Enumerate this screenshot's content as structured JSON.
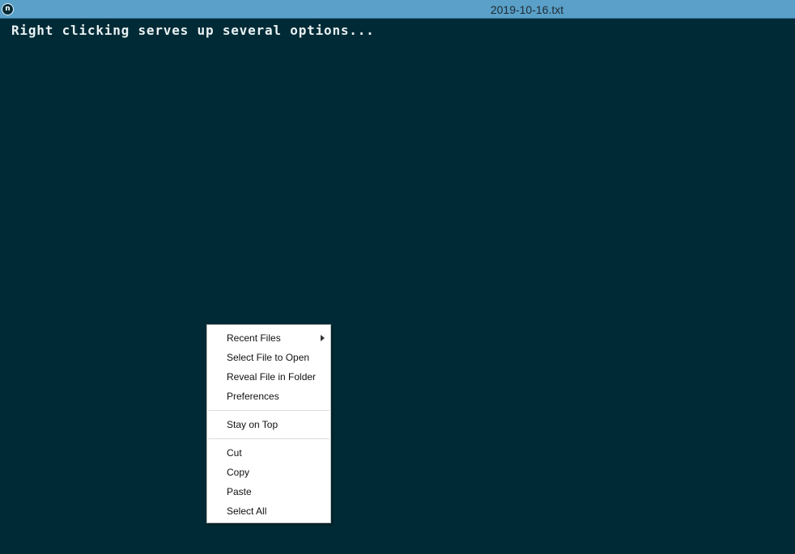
{
  "window": {
    "title": "2019-10-16.txt",
    "app_icon_letter": "n"
  },
  "editor": {
    "text": "Right clicking serves up several options..."
  },
  "context_menu": {
    "group_file": [
      {
        "label": "Recent Files",
        "has_submenu": true
      },
      {
        "label": "Select File to Open"
      },
      {
        "label": "Reveal File in Folder"
      },
      {
        "label": "Preferences"
      }
    ],
    "group_window": [
      {
        "label": "Stay on Top"
      }
    ],
    "group_edit": [
      {
        "label": "Cut"
      },
      {
        "label": "Copy"
      },
      {
        "label": "Paste"
      },
      {
        "label": "Select All"
      }
    ]
  },
  "colors": {
    "editor_background": "#002b36",
    "titlebar_background": "#5aa0c8",
    "editor_text": "#eaf2f4",
    "menu_background": "#ffffff"
  },
  "icons": {
    "app_icon": "app-logo-icon",
    "submenu": "chevron-right-icon"
  }
}
